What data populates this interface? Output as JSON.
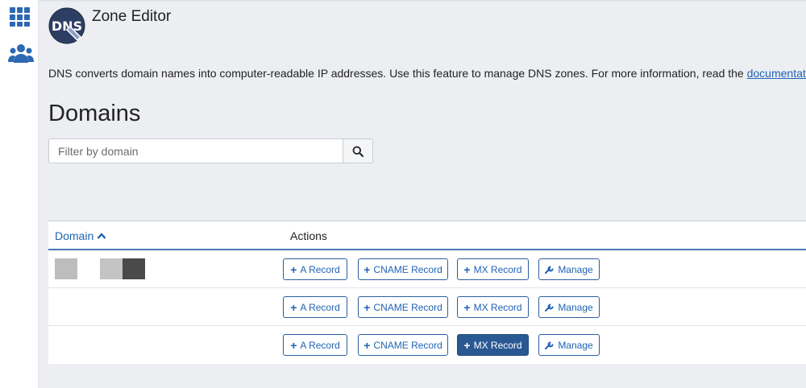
{
  "app": {
    "title": "Zone Editor",
    "logo_text": "DNS",
    "description": "DNS converts domain names into computer-readable IP addresses. Use this feature to manage DNS zones. For more information, read the ",
    "description_link": "documentation",
    "description_end": "."
  },
  "sidebar": {
    "items": [
      {
        "icon": "apps-grid-icon"
      },
      {
        "icon": "users-icon"
      }
    ]
  },
  "domains": {
    "heading": "Domains",
    "search_placeholder": "Filter by domain",
    "search_value": ""
  },
  "table": {
    "columns": {
      "domain": "Domain",
      "actions": "Actions"
    },
    "sort": "ascending",
    "rows": [
      {
        "domain": "",
        "actions": {
          "a": "A Record",
          "cname": "CNAME Record",
          "mx": "MX Record",
          "manage": "Manage"
        },
        "highlight": ""
      },
      {
        "domain": "",
        "actions": {
          "a": "A Record",
          "cname": "CNAME Record",
          "mx": "MX Record",
          "manage": "Manage"
        },
        "highlight": ""
      },
      {
        "domain": "",
        "actions": {
          "a": "A Record",
          "cname": "CNAME Record",
          "mx": "MX Record",
          "manage": "Manage"
        },
        "highlight": "mx"
      }
    ]
  },
  "colors": {
    "accent": "#1f62b5",
    "primary_button": "#2a5893",
    "background": "#eceef2"
  }
}
